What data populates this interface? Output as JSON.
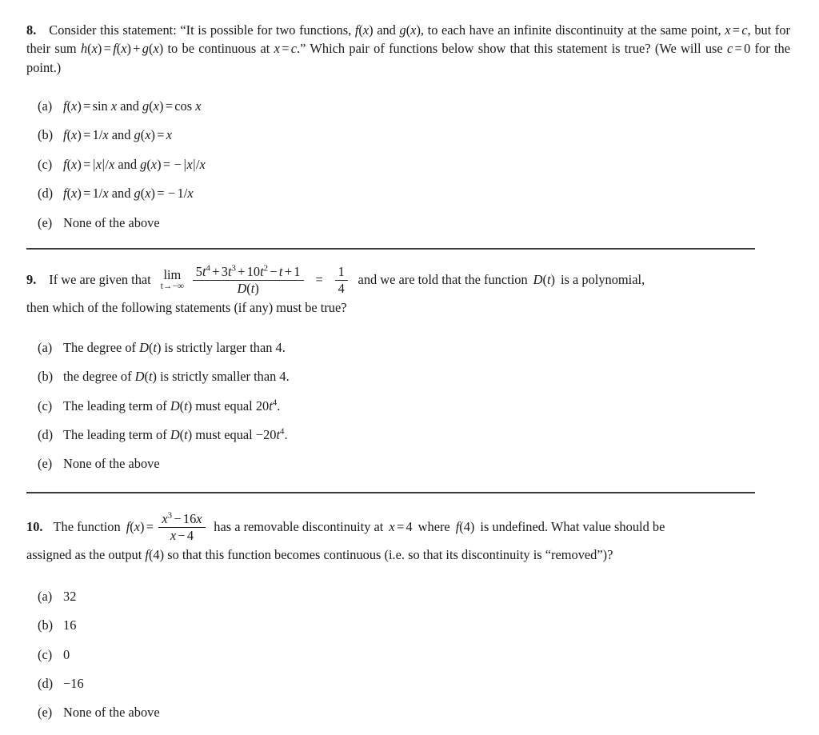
{
  "document": {
    "type": "calculus-multiple-choice-worksheet",
    "questions": [
      {
        "number": "8.",
        "prompt_line1_a": "Consider this statement: “It is possible for two functions, ",
        "prompt_f_of_x": "f(x)",
        "prompt_line1_b": " and ",
        "prompt_g_of_x": "g(x)",
        "prompt_line1_c": ", to each have an infinite discontinuity at the same point, ",
        "prompt_x_eq_c": "x = c",
        "prompt_line1_d": ", but for their sum ",
        "prompt_h_eq": "h(x) = f(x) + g(x)",
        "prompt_line1_e": " to be continuous at ",
        "prompt_x_eq_c_2": "x = c",
        "prompt_line1_f": ".” Which pair of functions below show that this statement is true? (We will use ",
        "prompt_c_eq_0": "c = 0",
        "prompt_line1_g": " for the point.)",
        "choices": [
          {
            "label": "(a)",
            "text": "f(x) = sin x and g(x) = cos x"
          },
          {
            "label": "(b)",
            "text": "f(x) = 1/x and g(x) = x"
          },
          {
            "label": "(c)",
            "text": "f(x) = |x|/x and g(x) = −|x|/x"
          },
          {
            "label": "(d)",
            "text": "f(x) = 1/x and g(x) = −1/x"
          },
          {
            "label": "(e)",
            "text": "None of the above"
          }
        ]
      },
      {
        "number": "9.",
        "prompt_pre": "If we are given that",
        "limit_operator": "lim",
        "limit_subscript": "t→−∞",
        "limit_numerator": "5t⁴ + 3t³ + 10t² − t + 1",
        "limit_denominator": "D(t)",
        "equals_sign": "=",
        "result_numerator": "1",
        "result_denominator": "4",
        "prompt_mid": "and we are told that the function",
        "prompt_Dt": "D(t)",
        "prompt_post": "is a polynomial,",
        "prompt_line2": "then which of the following statements (if any) must be true?",
        "choices": [
          {
            "label": "(a)",
            "text": "The degree of D(t) is strictly larger than 4."
          },
          {
            "label": "(b)",
            "text": "the degree of D(t) is strictly smaller than 4."
          },
          {
            "label": "(c)",
            "text": "The leading term of D(t) must equal 20t⁴."
          },
          {
            "label": "(d)",
            "text": "The leading term of D(t) must equal −20t⁴."
          },
          {
            "label": "(e)",
            "text": "None of the above"
          }
        ]
      },
      {
        "number": "10.",
        "prompt_pre": "The function",
        "prompt_f_eq": "f(x) =",
        "frac_numerator": "x³ − 16x",
        "frac_denominator": "x − 4",
        "prompt_mid": "has a removable discontinuity at",
        "prompt_x_eq_4": "x = 4",
        "prompt_mid2": "where",
        "prompt_f4": "f(4)",
        "prompt_post": "is undefined. What value should be",
        "prompt_line2_a": "assigned as the output ",
        "prompt_line2_f4": "f(4)",
        "prompt_line2_b": " so that this function becomes continuous (i.e. so that its discontinuity is “removed”)?",
        "choices": [
          {
            "label": "(a)",
            "text": "32"
          },
          {
            "label": "(b)",
            "text": "16"
          },
          {
            "label": "(c)",
            "text": "0"
          },
          {
            "label": "(d)",
            "text": "−16"
          },
          {
            "label": "(e)",
            "text": "None of the above"
          }
        ]
      }
    ],
    "dividers": [
      {
        "name": "divider-after-question-8"
      },
      {
        "name": "divider-after-question-9"
      }
    ]
  }
}
